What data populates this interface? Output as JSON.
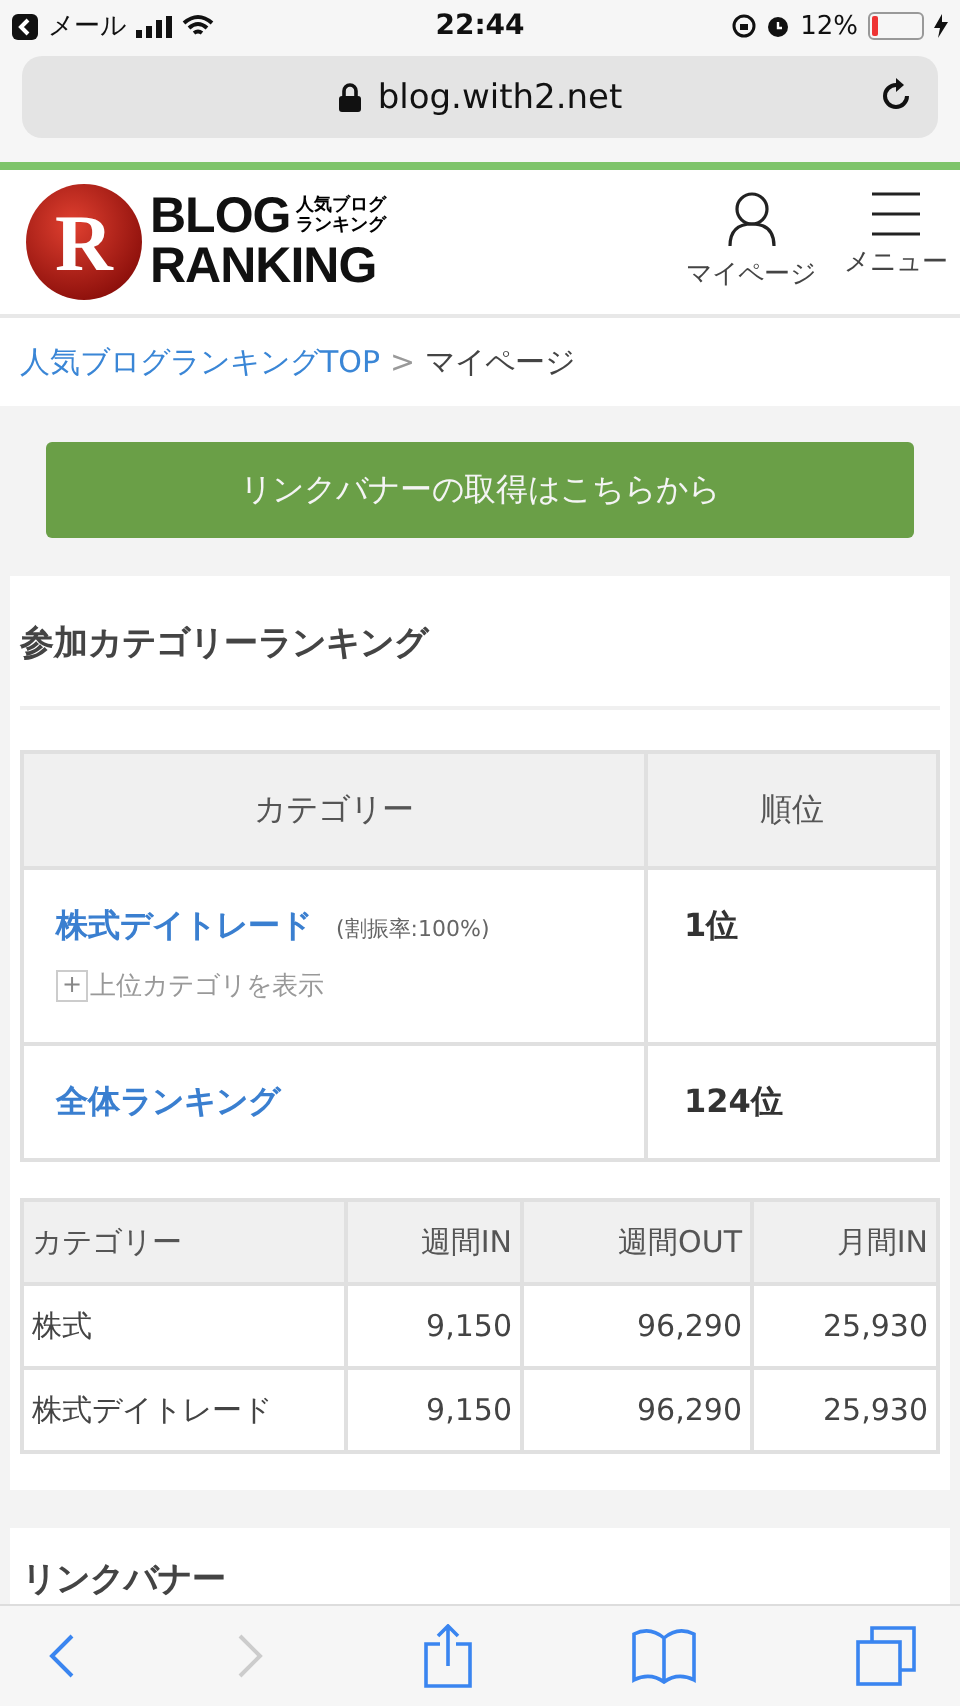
{
  "status_bar": {
    "back_app": "メール",
    "time": "22:44",
    "battery": "12%",
    "battery_gauge": {
      "level": 0.12
    }
  },
  "address_bar": {
    "url": "blog.with2.net"
  },
  "header": {
    "logo": {
      "mark": "R",
      "word1": "BLOG",
      "word2": "RANKING",
      "sub1": "人気ブログ",
      "sub2": "ランキング"
    },
    "actions": [
      {
        "label": "マイページ",
        "kind": "user"
      },
      {
        "label": "メニュー",
        "kind": "menu"
      }
    ]
  },
  "breadcrumb": {
    "link": "人気ブログランキングTOP",
    "separator": ">",
    "current": "マイページ"
  },
  "banner_button": "リンクバナーの取得はこちらから",
  "ranking_section": {
    "title": "参加カテゴリーランキング",
    "rank_table": {
      "columns": [
        "カテゴリー",
        "順位"
      ],
      "rows": [
        {
          "category": "株式デイトレード",
          "note": "(割振率:100%)",
          "toggle": "+",
          "toggle_label": "上位カテゴリを表示",
          "rank": "1位"
        },
        {
          "category": "全体ランキング",
          "rank": "124位"
        }
      ]
    },
    "stats_table": {
      "columns": [
        "カテゴリー",
        "週間IN",
        "週間OUT",
        "月間IN"
      ],
      "rows": [
        [
          "株式",
          "9,150",
          "96,290",
          "25,930"
        ],
        [
          "株式デイトレード",
          "9,150",
          "96,290",
          "25,930"
        ]
      ]
    }
  },
  "next_section": {
    "title": "リンクバナー"
  },
  "toolbar": {
    "back_disabled": false,
    "forward_disabled": true
  }
}
